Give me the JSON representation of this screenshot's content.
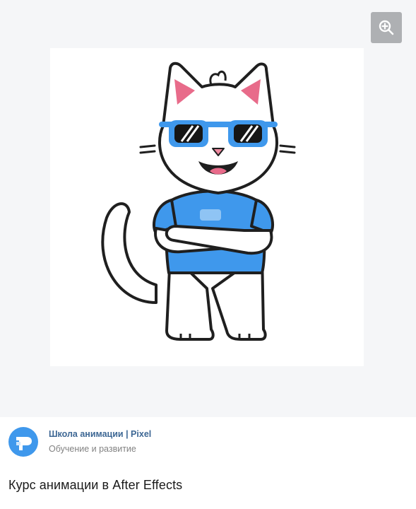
{
  "post": {
    "author_name": "Школа анимации | Pixel",
    "author_category": "Обучение и развитие",
    "title": "Курс анимации в After Effects"
  },
  "media": {
    "zoom_icon": "zoom-in-icon",
    "image_subject": "cartoon-cat-sunglasses"
  },
  "colors": {
    "accent_blue": "#3f98ec",
    "author_link": "#3d6794",
    "media_background": "#f5f6f8",
    "zoom_button": "#aeb0b3"
  }
}
